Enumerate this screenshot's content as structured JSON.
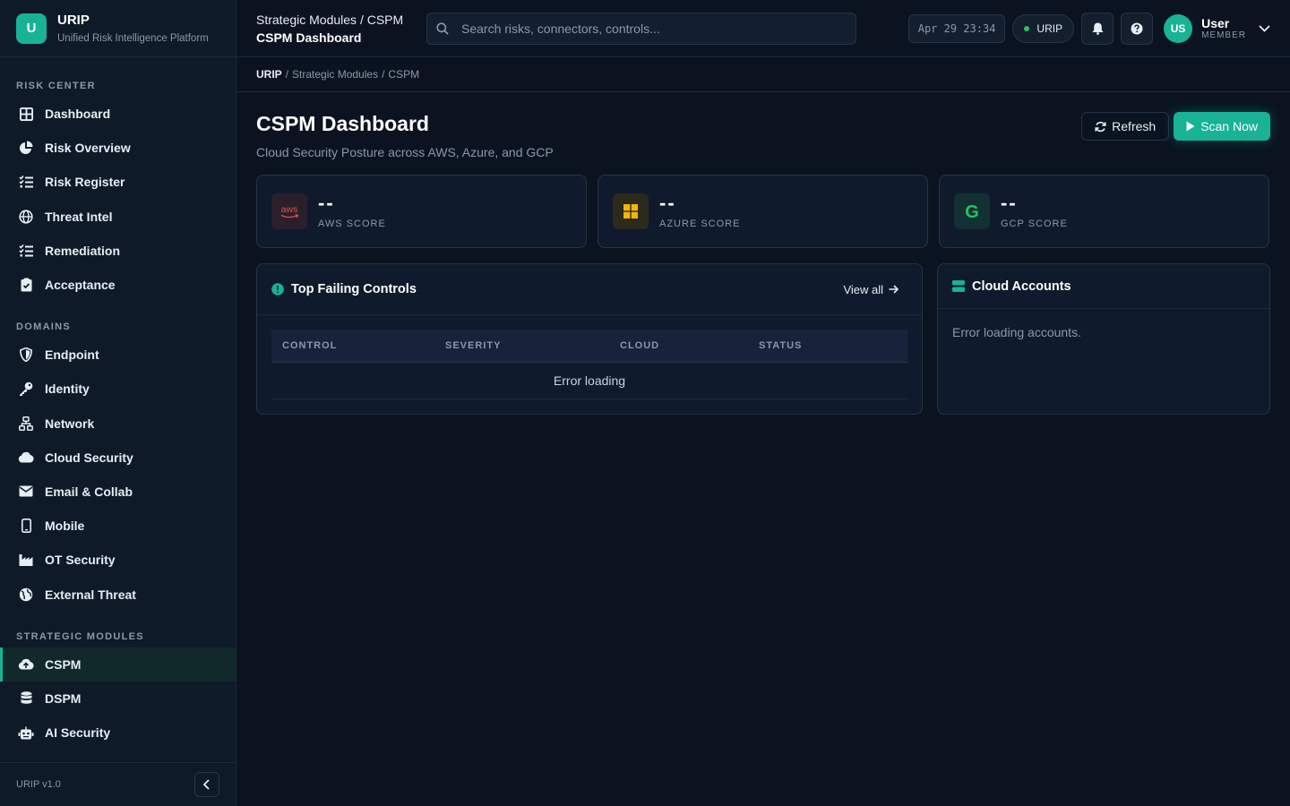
{
  "brand": {
    "logo_letter": "U",
    "title": "URIP",
    "subtitle": "Unified Risk Intelligence Platform"
  },
  "sidebar": {
    "sections": [
      {
        "heading": "RISK CENTER",
        "items": [
          "Dashboard",
          "Risk Overview",
          "Risk Register",
          "Threat Intel",
          "Remediation",
          "Acceptance"
        ]
      },
      {
        "heading": "DOMAINS",
        "items": [
          "Endpoint",
          "Identity",
          "Network",
          "Cloud Security",
          "Email & Collab",
          "Mobile",
          "OT Security",
          "External Threat"
        ]
      },
      {
        "heading": "STRATEGIC MODULES",
        "items": [
          "CSPM",
          "DSPM",
          "AI Security"
        ]
      }
    ],
    "active_item": "CSPM",
    "version": "URIP v1.0"
  },
  "topbar": {
    "crumb_line1": "Strategic Modules / CSPM",
    "crumb_line2": "CSPM Dashboard",
    "search_placeholder": "Search risks, connectors, controls...",
    "clock": "Apr 29 23:34",
    "tenant": "URIP",
    "user_initials": "US",
    "user_name": "User",
    "user_role": "MEMBER"
  },
  "breadcrumb": {
    "root": "URIP",
    "sep1": "/",
    "mid": "Strategic Modules",
    "sep2": "/",
    "leaf": "CSPM"
  },
  "page": {
    "title": "CSPM Dashboard",
    "subtitle": "Cloud Security Posture across AWS, Azure, and GCP",
    "refresh_label": "Refresh",
    "scan_label": "Scan Now"
  },
  "scores": [
    {
      "icon_text": "aws",
      "value": "--",
      "label": "AWS SCORE"
    },
    {
      "value": "--",
      "label": "AZURE SCORE"
    },
    {
      "icon_text": "G",
      "value": "--",
      "label": "GCP SCORE"
    }
  ],
  "failing_controls": {
    "title": "Top Failing Controls",
    "view_all": "View all",
    "columns": [
      "CONTROL",
      "SEVERITY",
      "CLOUD",
      "STATUS"
    ],
    "empty_message": "Error loading"
  },
  "cloud_accounts": {
    "title": "Cloud Accounts",
    "message": "Error loading accounts."
  },
  "colors": {
    "accent": "#17b394",
    "background": "#0b1320",
    "panel": "#0f1b2c",
    "aws": "#e0524b",
    "azure": "#f2b705",
    "gcp": "#22c55e"
  },
  "icons": {
    "risk_center": [
      "grid-icon",
      "pie-chart-icon",
      "list-check-icon",
      "globe-icon",
      "list-check-icon",
      "clipboard-check-icon"
    ],
    "domains": [
      "shield-icon",
      "key-icon",
      "network-icon",
      "cloud-icon",
      "envelope-icon",
      "mobile-icon",
      "industry-icon",
      "globe-icon"
    ],
    "strategic": [
      "cloud-upload-icon",
      "database-icon",
      "robot-icon"
    ]
  }
}
